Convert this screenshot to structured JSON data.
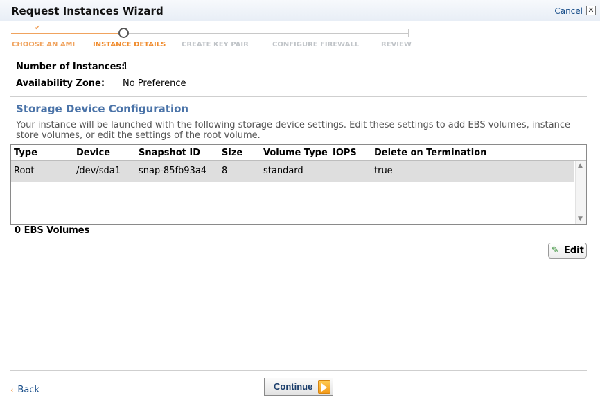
{
  "window": {
    "title": "Request Instances Wizard",
    "cancel_label": "Cancel",
    "close_glyph": "✕"
  },
  "steps": [
    {
      "label": "CHOOSE AN AMI",
      "state": "done"
    },
    {
      "label": "INSTANCE DETAILS",
      "state": "active"
    },
    {
      "label": "CREATE KEY PAIR",
      "state": "todo"
    },
    {
      "label": "CONFIGURE FIREWALL",
      "state": "todo"
    },
    {
      "label": "REVIEW",
      "state": "todo"
    }
  ],
  "details": {
    "instances_label": "Number of Instances:",
    "instances_value": "1",
    "zone_label": "Availability Zone:",
    "zone_value": "No Preference"
  },
  "storage": {
    "title": "Storage Device Configuration",
    "description": "Your instance will be launched with the following storage device settings. Edit these settings to add EBS volumes, instance store volumes, or edit the settings of the root volume.",
    "columns": [
      "Type",
      "Device",
      "Snapshot ID",
      "Size",
      "Volume Type",
      "IOPS",
      "Delete on Termination"
    ],
    "rows": [
      {
        "type": "Root",
        "device": "/dev/sda1",
        "snapshot": "snap-85fb93a4",
        "size": "8",
        "volume_type": "standard",
        "iops": "",
        "delete_on_termination": "true"
      }
    ],
    "ebs_count": "0 EBS Volumes",
    "edit_label": "Edit"
  },
  "footer": {
    "back_label": "Back",
    "continue_label": "Continue"
  },
  "colors": {
    "accent": "#f08c2e",
    "link": "#1a4f8a",
    "section_title": "#4a73a8"
  },
  "icons": {
    "edit": "pencil-icon",
    "continue": "play-arrow-icon",
    "close": "close-icon",
    "back": "chevron-left-icon"
  }
}
